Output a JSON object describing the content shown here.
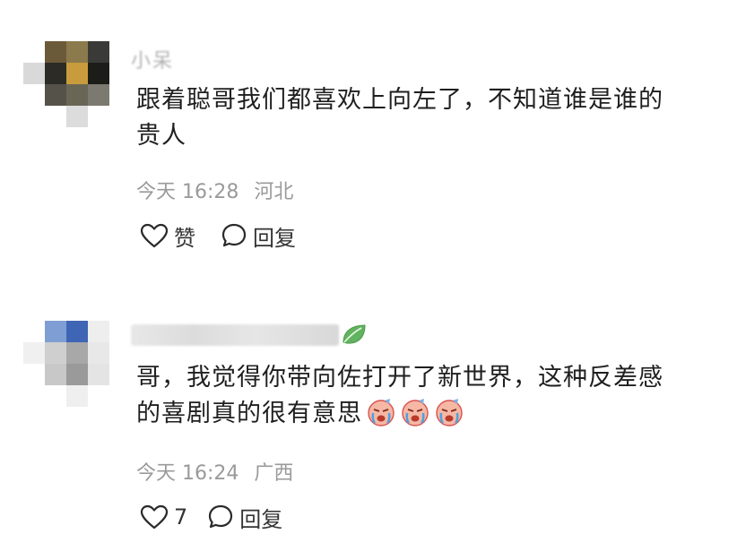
{
  "comments": [
    {
      "author_fragment": "小呆",
      "text_line1": "跟着聪哥我们都喜欢上向左了，不知道谁是谁的",
      "text_line2": "贵人",
      "time": "今天 16:28",
      "location": "河北",
      "like_label": "赞",
      "reply_label": "回复"
    },
    {
      "text_line1": "哥，我觉得你带向佐打开了新世界，这种反差感",
      "text_line2": "的喜剧真的很有意思",
      "time": "今天 16:24",
      "location": "广西",
      "like_count": "7",
      "reply_label": "回复"
    }
  ],
  "icons": {
    "like": "heart-outline-icon",
    "reply": "speech-bubble-icon",
    "badge": "green-leaf-icon",
    "emoji": "crying-face-emoji"
  },
  "colors": {
    "text": "#1f1f1f",
    "meta": "#9a9a9a",
    "leaf": "#5cb85c"
  }
}
